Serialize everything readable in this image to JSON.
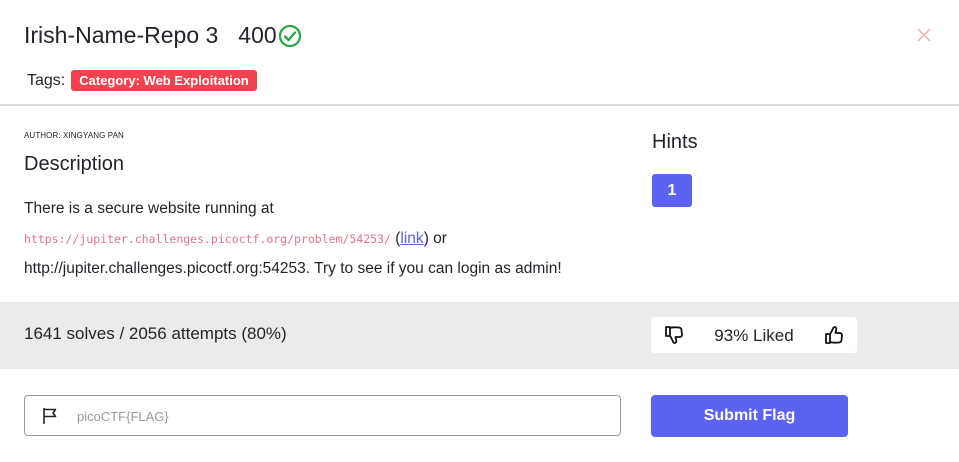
{
  "challenge": {
    "title": "Irish-Name-Repo 3",
    "points": "400",
    "tags_label": "Tags:",
    "tags": [
      "Category: Web Exploitation"
    ],
    "author": "AUTHOR: XINGYANG PAN",
    "description_heading": "Description",
    "description": {
      "line1": "There is a secure website running at",
      "url_code": "https://jupiter.challenges.picoctf.org/problem/54253/",
      "link_open": " (",
      "link_text": "link",
      "link_close": ") or",
      "line3": "http://jupiter.challenges.picoctf.org:54253. Try to see if you can login as admin!"
    },
    "hints_heading": "Hints",
    "hints": [
      "1"
    ]
  },
  "stats": {
    "solves_text": "1641 solves / 2056 attempts (80%)",
    "liked_text": "93% Liked"
  },
  "flag_form": {
    "placeholder": "picoCTF{FLAG}",
    "value": "",
    "submit_label": "Submit Flag"
  },
  "icons": {
    "solved": "check-circle-icon",
    "close": "close-icon",
    "dislike": "thumbs-down-icon",
    "like": "thumbs-up-icon",
    "flag": "flag-icon"
  },
  "colors": {
    "accent": "#5b63f0",
    "tag": "#f0424f",
    "solved": "#28a745",
    "stats_bg": "#ebebeb",
    "code": "#e0738c"
  }
}
